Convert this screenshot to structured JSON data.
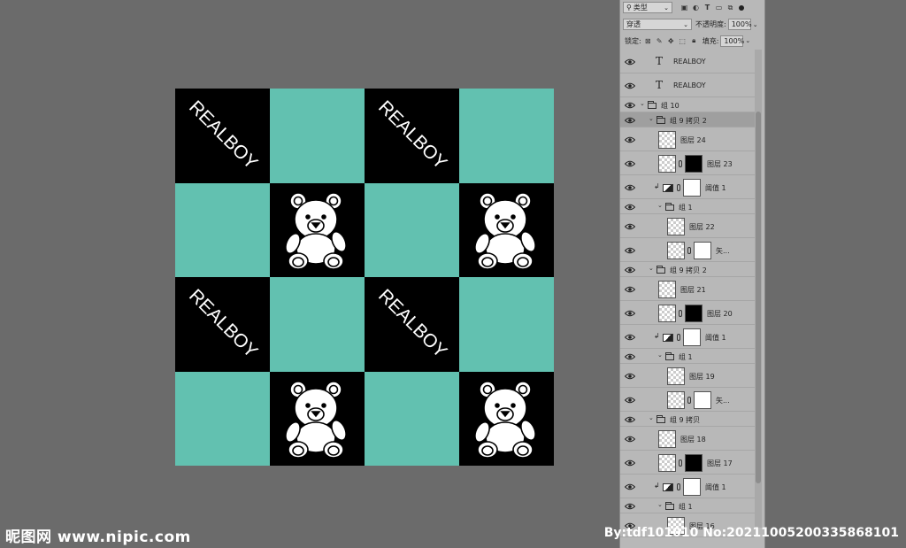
{
  "canvas": {
    "colors": {
      "teal": "#62c1b0",
      "black": "#000000",
      "text": "#ffffff"
    },
    "word": "REALBOY",
    "tiles": [
      "word",
      "teal",
      "word",
      "teal",
      "teal",
      "bear",
      "teal",
      "bear",
      "word",
      "teal",
      "word",
      "teal",
      "teal",
      "bear",
      "teal",
      "bear"
    ]
  },
  "panel": {
    "filter_select": "类型",
    "blend_mode": "穿透",
    "opacity_label": "不透明度:",
    "opacity_value": "100%",
    "lock_label": "锁定:",
    "fill_label": "填充:",
    "fill_value": "100%",
    "filter_icons": [
      "image-filter-icon",
      "adjustment-filter-icon",
      "text-filter-icon",
      "shape-filter-icon",
      "smart-object-filter-icon"
    ],
    "layers": [
      {
        "name": "REALBOY",
        "kind": "text",
        "indent": 0
      },
      {
        "name": "REALBOY",
        "kind": "text",
        "indent": 0
      },
      {
        "name": "组 10",
        "kind": "group",
        "indent": 0
      },
      {
        "name": "组 9 拷贝 2",
        "kind": "group",
        "indent": 1,
        "selected": true
      },
      {
        "name": "图层 24",
        "kind": "pixel",
        "indent": 2
      },
      {
        "name": "图层 23",
        "kind": "masked",
        "indent": 2
      },
      {
        "name": "阈值 1",
        "kind": "adjust",
        "indent": 2
      },
      {
        "name": "组 1",
        "kind": "group",
        "indent": 2
      },
      {
        "name": "图层 22",
        "kind": "pixel",
        "indent": 3
      },
      {
        "name": "矢...",
        "kind": "smart",
        "indent": 3
      },
      {
        "name": "组 9 拷贝 2",
        "kind": "group",
        "indent": 1
      },
      {
        "name": "图层 21",
        "kind": "pixel",
        "indent": 2
      },
      {
        "name": "图层 20",
        "kind": "masked",
        "indent": 2
      },
      {
        "name": "阈值 1",
        "kind": "adjust",
        "indent": 2
      },
      {
        "name": "组 1",
        "kind": "group",
        "indent": 2
      },
      {
        "name": "图层 19",
        "kind": "pixel",
        "indent": 3
      },
      {
        "name": "矢...",
        "kind": "smart",
        "indent": 3
      },
      {
        "name": "组 9 拷贝",
        "kind": "group",
        "indent": 1
      },
      {
        "name": "图层 18",
        "kind": "pixel",
        "indent": 2
      },
      {
        "name": "图层 17",
        "kind": "masked",
        "indent": 2
      },
      {
        "name": "阈值 1",
        "kind": "adjust",
        "indent": 2
      },
      {
        "name": "组 1",
        "kind": "group",
        "indent": 2
      },
      {
        "name": "图层 16",
        "kind": "pixel",
        "indent": 3
      }
    ]
  },
  "watermark": {
    "left": "昵图网 www.nipic.com",
    "right": "By:tdf101010 No:20211005200335868101"
  }
}
